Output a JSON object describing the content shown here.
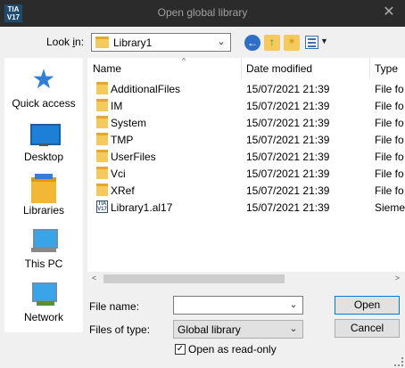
{
  "window": {
    "app_icon_text": "TIA\nV17",
    "title": "Open global library",
    "close_glyph": "✕"
  },
  "lookin": {
    "label_pre": "Look ",
    "label_underline": "i",
    "label_post": "n:",
    "value": "Library1"
  },
  "toolbar": {
    "back_icon": "back-arrow-icon",
    "up_icon": "up-folder-icon",
    "new_folder_icon": "new-folder-icon",
    "views_icon": "view-menu-icon"
  },
  "places": [
    {
      "label": "Quick access",
      "icon": "star-icon"
    },
    {
      "label": "Desktop",
      "icon": "desktop-icon"
    },
    {
      "label": "Libraries",
      "icon": "libraries-icon"
    },
    {
      "label": "This PC",
      "icon": "computer-icon"
    },
    {
      "label": "Network",
      "icon": "network-icon"
    }
  ],
  "columns": {
    "name": "Name",
    "date": "Date modified",
    "type": "Type"
  },
  "files": [
    {
      "name": "AdditionalFiles",
      "date": "15/07/2021 21:39",
      "type": "File fo",
      "kind": "folder"
    },
    {
      "name": "IM",
      "date": "15/07/2021 21:39",
      "type": "File fo",
      "kind": "folder"
    },
    {
      "name": "System",
      "date": "15/07/2021 21:39",
      "type": "File fo",
      "kind": "folder"
    },
    {
      "name": "TMP",
      "date": "15/07/2021 21:39",
      "type": "File fo",
      "kind": "folder"
    },
    {
      "name": "UserFiles",
      "date": "15/07/2021 21:39",
      "type": "File fo",
      "kind": "folder"
    },
    {
      "name": "Vci",
      "date": "15/07/2021 21:39",
      "type": "File fo",
      "kind": "folder"
    },
    {
      "name": "XRef",
      "date": "15/07/2021 21:39",
      "type": "File fo",
      "kind": "folder"
    },
    {
      "name": "Library1.al17",
      "date": "15/07/2021 21:39",
      "type": "Siemen",
      "kind": "tia"
    }
  ],
  "form": {
    "file_name_label": "File name:",
    "file_name_value": "",
    "file_type_label": "Files of type:",
    "file_type_value": "Global library",
    "open_label": "Open",
    "cancel_label": "Cancel",
    "readonly_label": "Open as read-only",
    "readonly_checked": true
  }
}
